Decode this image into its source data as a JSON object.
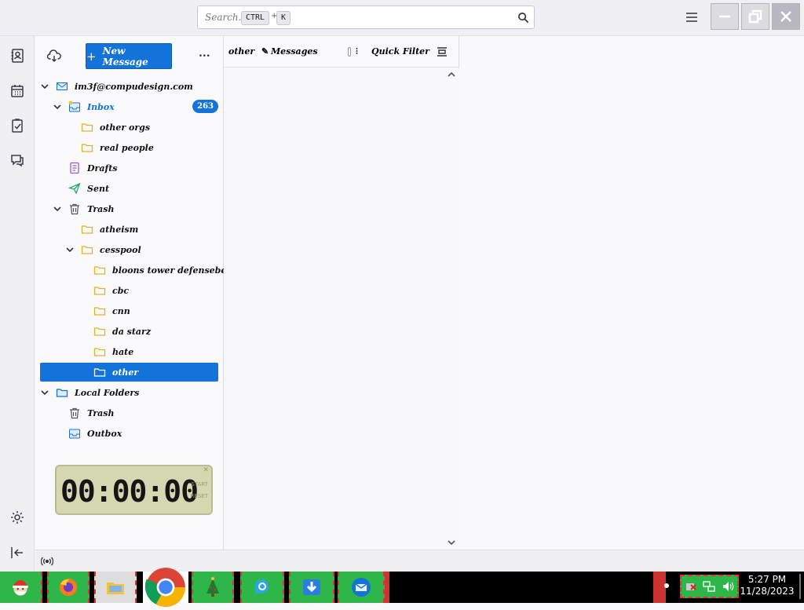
{
  "app": {
    "search_placeholder": "Search...",
    "search_key_ctrl": "CTRL",
    "search_key_sep": "+",
    "search_key_k": "K",
    "new_message_label": "New Message",
    "more_label": "..."
  },
  "folders": {
    "account": "im3f@compudesign.com",
    "inbox": {
      "label": "Inbox",
      "unread": "263"
    },
    "other_orgs": "other orgs",
    "real_people": "real people",
    "drafts": "Drafts",
    "sent": "Sent",
    "trash": "Trash",
    "atheism": "atheism",
    "cesspool": "cesspool",
    "bloons": "bloons tower defenseberg",
    "cbc": "cbc",
    "cnn": "cnn",
    "da_starz": "da starz",
    "hate": "hate",
    "other": "other",
    "local_folders": "Local Folders",
    "local_trash": "Trash",
    "outbox": "Outbox"
  },
  "message_list": {
    "folder_name": "other",
    "messages_label": "Messages",
    "quick_filter_label": "Quick Filter"
  },
  "stopwatch": {
    "time": "00:00:00",
    "start_label": "START",
    "reset_label": "RESET"
  },
  "taskbar": {
    "time": "5:27 PM",
    "date": "11/28/2023"
  },
  "colors": {
    "accent": "#1373d9",
    "taskbar_button": "#2fb64a",
    "taskbar_border": "#dd3333"
  },
  "icons": [
    "mail-icon",
    "address-book-icon",
    "calendar-icon",
    "tasks-icon",
    "chat-icon",
    "settings-icon",
    "collapse-sidebar-icon",
    "sync-icon",
    "search-icon",
    "folder-icon",
    "inbox-icon",
    "drafts-icon",
    "sent-icon",
    "trash-icon",
    "outbox-icon",
    "quick-filter-icon",
    "display-options-icon"
  ]
}
